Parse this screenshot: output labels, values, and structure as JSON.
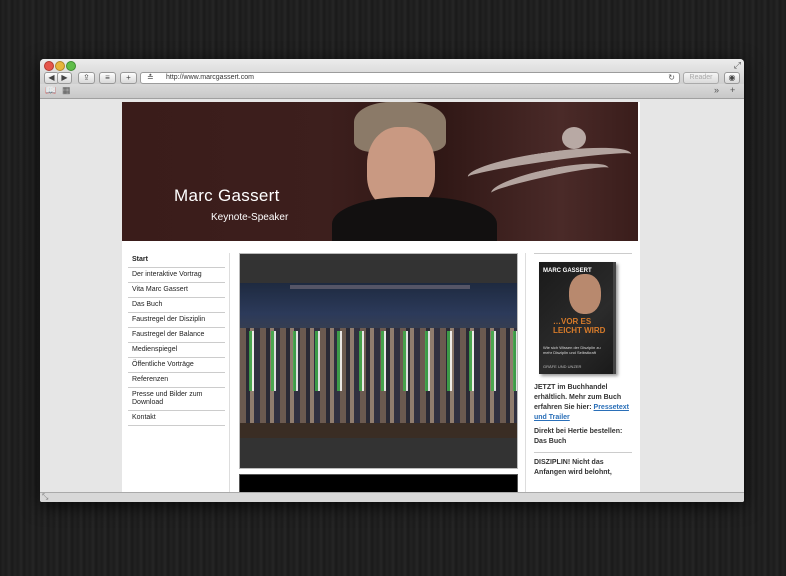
{
  "browser": {
    "url": "http://www.marcgassert.com",
    "reader_label": "Reader",
    "icons": [
      "back-icon",
      "forward-icon",
      "share-icon",
      "reading-list-icon",
      "new-tab-icon",
      "reload-icon",
      "downloads-icon",
      "bookmarks-icon",
      "top-sites-icon",
      "overflow-icon"
    ]
  },
  "banner": {
    "name": "Marc Gassert",
    "role": "Keynote-Speaker"
  },
  "nav": {
    "items": [
      {
        "label": "Start"
      },
      {
        "label": "Der interaktive Vortrag"
      },
      {
        "label": "Vita Marc Gassert"
      },
      {
        "label": "Das Buch"
      },
      {
        "label": "Faustregel der Disziplin"
      },
      {
        "label": "Faustregel der Balance"
      },
      {
        "label": "Medienspiegel"
      },
      {
        "label": "Öffentliche Vorträge"
      },
      {
        "label": "Referenzen"
      },
      {
        "label": "Presse und Bilder zum Download"
      },
      {
        "label": "Kontakt"
      }
    ]
  },
  "book": {
    "author": "MARC GASSERT",
    "title": "…VOR ES LEICHT WIRD",
    "subtitle": "Wie sich Wissen der Disziplin zu mehr Disziplin und Selbstkraft",
    "publisher": "GRÄFE UND UNZER"
  },
  "sidebar": {
    "promo_text": "JETZT im Buchhandel erhältlich. Mehr zum Buch erfahren Sie hier:",
    "promo_link": "Pressetext und Trailer",
    "order_text": "Direkt bei Hertie bestellen:",
    "order_link": "Das Buch",
    "teaser": "DISZIPLIN! Nicht das Anfangen wird belohnt,"
  }
}
